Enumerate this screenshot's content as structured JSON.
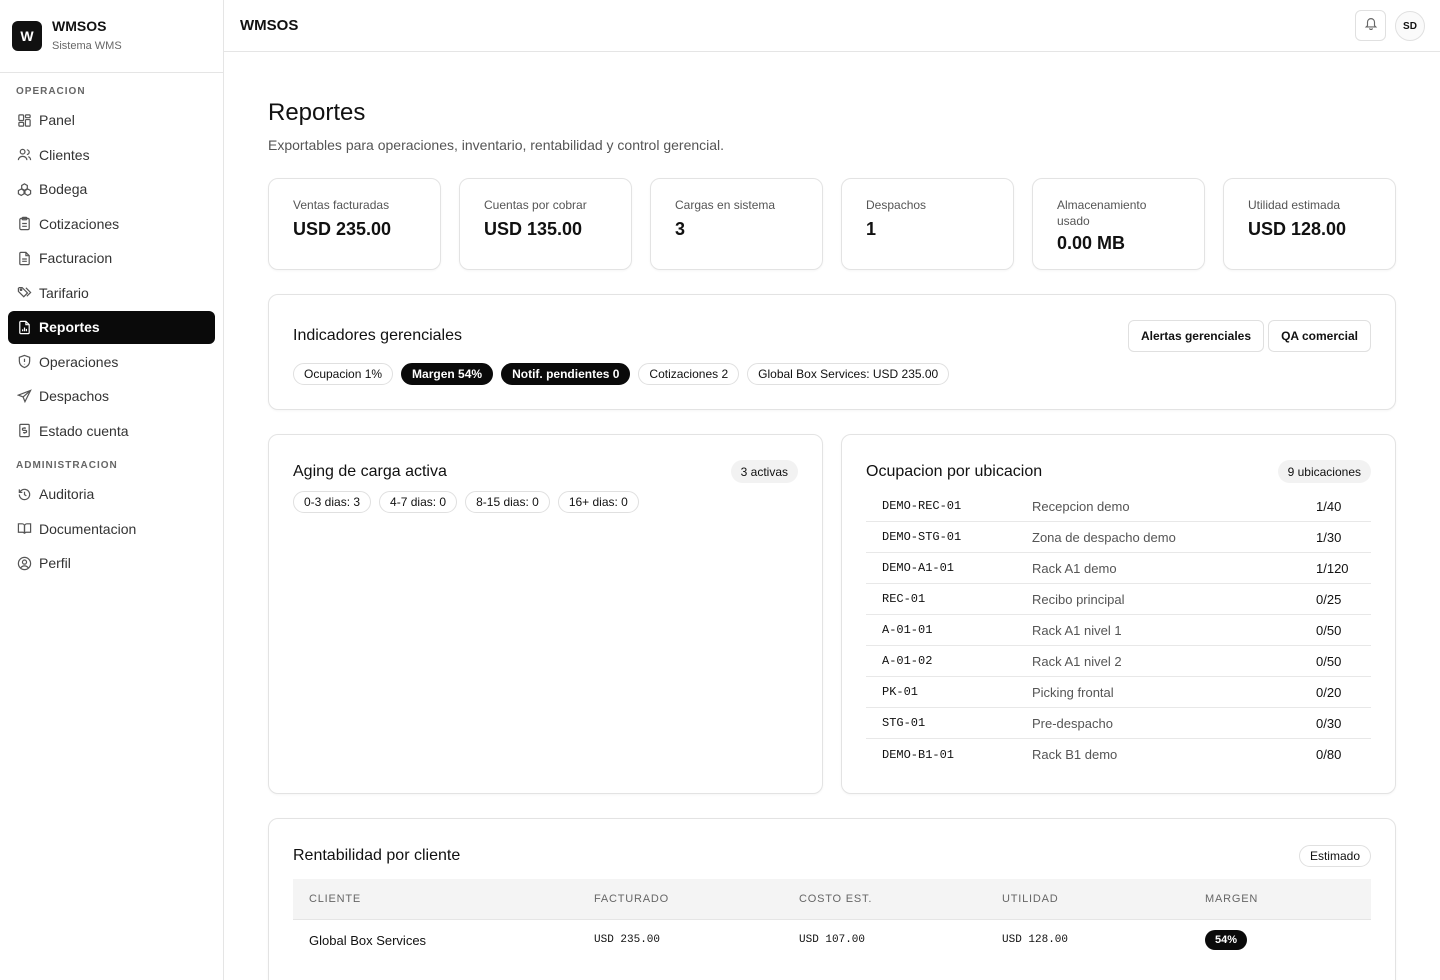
{
  "brand": {
    "logo_letter": "W",
    "name": "WMSOS",
    "subtitle": "Sistema WMS"
  },
  "sidebar": {
    "section_operacion": "OPERACION",
    "section_administracion": "ADMINISTRACION",
    "items": [
      {
        "label": "Panel",
        "icon": "grid-icon"
      },
      {
        "label": "Clientes",
        "icon": "users-icon"
      },
      {
        "label": "Bodega",
        "icon": "boxes-icon"
      },
      {
        "label": "Cotizaciones",
        "icon": "clipboard-icon"
      },
      {
        "label": "Facturacion",
        "icon": "file-text-icon"
      },
      {
        "label": "Tarifario",
        "icon": "tags-icon"
      },
      {
        "label": "Reportes",
        "icon": "file-chart-icon",
        "active": true
      },
      {
        "label": "Operaciones",
        "icon": "shield-icon"
      },
      {
        "label": "Despachos",
        "icon": "send-icon"
      },
      {
        "label": "Estado cuenta",
        "icon": "receipt-icon"
      },
      {
        "label": "Auditoria",
        "icon": "history-icon"
      },
      {
        "label": "Documentacion",
        "icon": "book-icon"
      },
      {
        "label": "Perfil",
        "icon": "user-circle-icon"
      }
    ]
  },
  "topbar": {
    "title": "WMSOS",
    "avatar_initials": "SD"
  },
  "page": {
    "title": "Reportes",
    "subtitle": "Exportables para operaciones, inventario, rentabilidad y control gerencial."
  },
  "kpis": [
    {
      "label": "Ventas facturadas",
      "value": "USD 235.00"
    },
    {
      "label": "Cuentas por cobrar",
      "value": "USD 135.00"
    },
    {
      "label": "Cargas en sistema",
      "value": "3"
    },
    {
      "label": "Despachos",
      "value": "1"
    },
    {
      "label": "Almacenamiento usado",
      "value": "0.00 MB"
    },
    {
      "label": "Utilidad estimada",
      "value": "USD 128.00"
    }
  ],
  "indicadores": {
    "title": "Indicadores gerenciales",
    "btn_alertas": "Alertas gerenciales",
    "btn_qa": "QA comercial",
    "chips": [
      {
        "label": "Ocupacion 1%",
        "dark": false
      },
      {
        "label": "Margen 54%",
        "dark": true
      },
      {
        "label": "Notif. pendientes 0",
        "dark": true
      },
      {
        "label": "Cotizaciones 2",
        "dark": false
      },
      {
        "label": "Global Box Services: USD 235.00",
        "dark": false
      }
    ]
  },
  "aging": {
    "title": "Aging de carga activa",
    "badge": "3 activas",
    "chips": [
      "0-3 dias: 3",
      "4-7 dias: 0",
      "8-15 dias: 0",
      "16+ dias: 0"
    ]
  },
  "ocupacion": {
    "title": "Ocupacion por ubicacion",
    "badge": "9 ubicaciones",
    "rows": [
      {
        "code": "DEMO-REC-01",
        "name": "Recepcion demo",
        "value": "1/40"
      },
      {
        "code": "DEMO-STG-01",
        "name": "Zona de despacho demo",
        "value": "1/30"
      },
      {
        "code": "DEMO-A1-01",
        "name": "Rack A1 demo",
        "value": "1/120"
      },
      {
        "code": "REC-01",
        "name": "Recibo principal",
        "value": "0/25"
      },
      {
        "code": "A-01-01",
        "name": "Rack A1 nivel 1",
        "value": "0/50"
      },
      {
        "code": "A-01-02",
        "name": "Rack A1 nivel 2",
        "value": "0/50"
      },
      {
        "code": "PK-01",
        "name": "Picking frontal",
        "value": "0/20"
      },
      {
        "code": "STG-01",
        "name": "Pre-despacho",
        "value": "0/30"
      },
      {
        "code": "DEMO-B1-01",
        "name": "Rack B1 demo",
        "value": "0/80"
      }
    ]
  },
  "rentabilidad": {
    "title": "Rentabilidad por cliente",
    "badge": "Estimado",
    "headers": {
      "cliente": "CLIENTE",
      "facturado": "FACTURADO",
      "costo": "COSTO EST.",
      "utilidad": "UTILIDAD",
      "margen": "MARGEN"
    },
    "rows": [
      {
        "cliente": "Global Box Services",
        "facturado": "USD 235.00",
        "costo": "USD 107.00",
        "utilidad": "USD 128.00",
        "margen": "54%"
      }
    ]
  }
}
